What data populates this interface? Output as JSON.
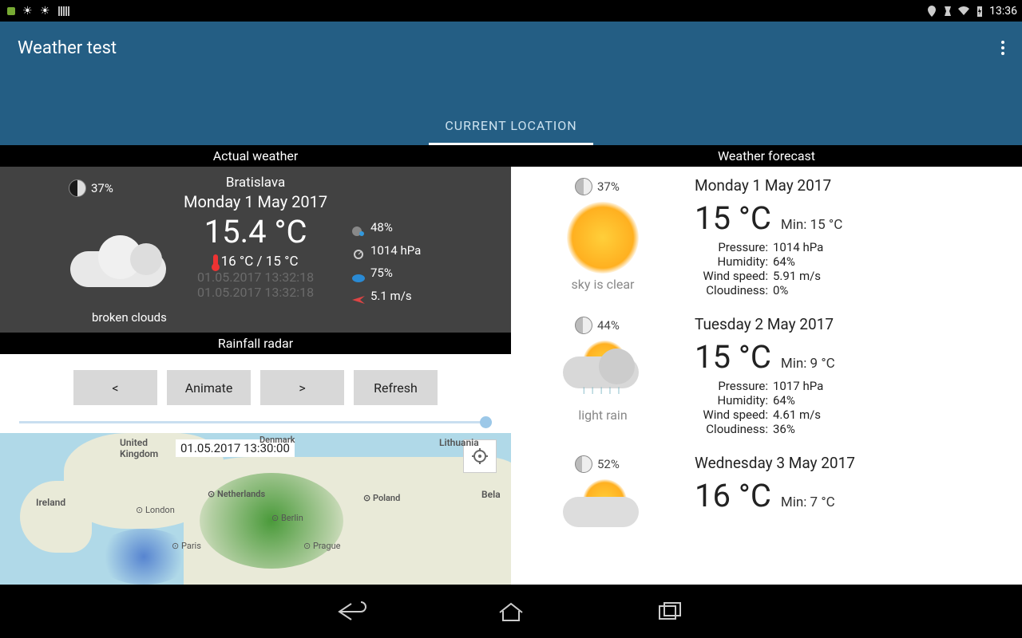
{
  "status": {
    "time": "13:36"
  },
  "app": {
    "title": "Weather test",
    "tab": "CURRENT LOCATION"
  },
  "left": {
    "header": "Actual weather",
    "moon": "37%",
    "city": "Bratislava",
    "date": "Monday 1 May 2017",
    "temp": "15.4 °C",
    "minmax": "16 °C / 15 °C",
    "timestamp1": "01.05.2017 13:32:18",
    "timestamp2": "01.05.2017 13:32:18",
    "desc": "broken clouds",
    "humidity": "48%",
    "pressure": "1014 hPa",
    "cloud": "75%",
    "wind": "5.1 m/s"
  },
  "radar": {
    "header": "Rainfall radar",
    "prev": "<",
    "animate": "Animate",
    "next": ">",
    "refresh": "Refresh",
    "map_timestamp": "01.05.2017 13:30:00",
    "labels": {
      "uk": "United\nKingdom",
      "ireland": "Ireland",
      "denmark": "Denmark",
      "lithuania": "Lithuania",
      "bela": "Bela",
      "netherlands": "Netherlands",
      "poland": "Poland",
      "london": "London",
      "berlin": "Berlin",
      "paris": "Paris",
      "prague": "Prague"
    }
  },
  "right": {
    "header": "Weather forecast",
    "items": [
      {
        "moon": "37%",
        "date": "Monday 1 May 2017",
        "temp": "15 °C",
        "min": "Min: 15 °C",
        "desc": "sky is clear",
        "pressure": "1014 hPa",
        "humidity": "64%",
        "wind": "5.91 m/s",
        "cloud": "0%"
      },
      {
        "moon": "44%",
        "date": "Tuesday 2 May 2017",
        "temp": "15 °C",
        "min": "Min: 9 °C",
        "desc": "light rain",
        "pressure": "1017 hPa",
        "humidity": "64%",
        "wind": "4.61 m/s",
        "cloud": "36%"
      },
      {
        "moon": "52%",
        "date": "Wednesday 3 May 2017",
        "temp": "16 °C",
        "min": "Min: 7 °C",
        "desc": "",
        "pressure": "",
        "humidity": "",
        "wind": "",
        "cloud": ""
      }
    ],
    "labels": {
      "pressure": "Pressure:",
      "humidity": "Humidity:",
      "wind": "Wind speed:",
      "cloud": "Cloudiness:"
    }
  }
}
